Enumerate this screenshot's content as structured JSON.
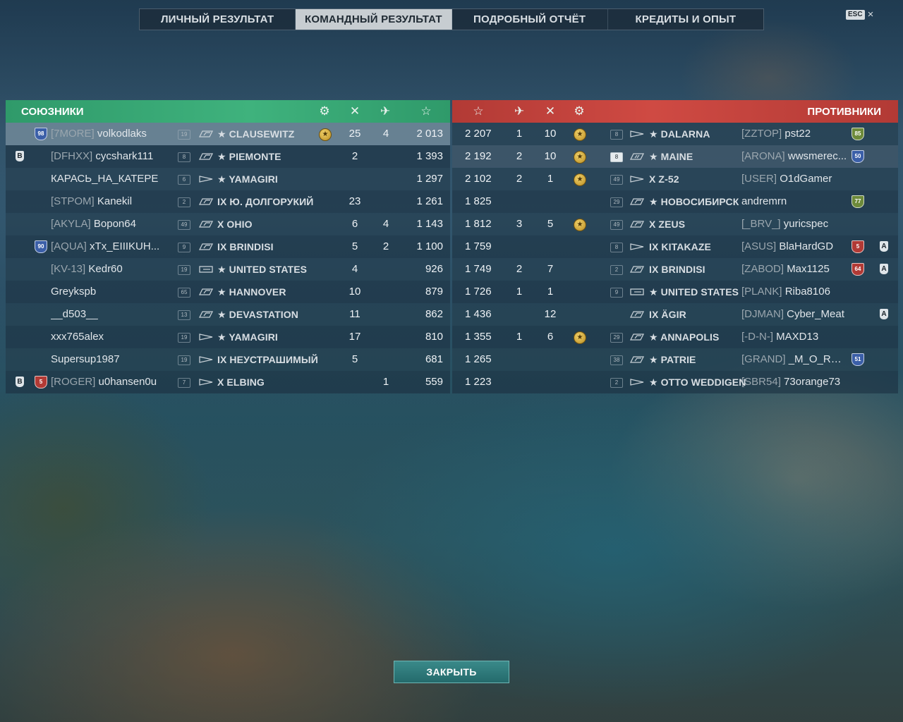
{
  "tabs": [
    {
      "label": "ЛИЧНЫЙ РЕЗУЛЬТАТ"
    },
    {
      "label": "КОМАНДНЫЙ РЕЗУЛЬТАТ"
    },
    {
      "label": "ПОДРОБНЫЙ ОТЧЁТ"
    },
    {
      "label": "КРЕДИТЫ И ОПЫТ"
    }
  ],
  "active_tab": "КОМАНДНЫЙ РЕЗУЛЬТАТ",
  "esc": {
    "key": "ESC",
    "close_icon": "×"
  },
  "colors": {
    "allies": "#3fb27d",
    "enemies": "#cf4a43",
    "row": "#1e3444",
    "highlight": "#768e9e"
  },
  "allies": {
    "title": "СОЮЗНИКИ",
    "header_icons": [
      "medal-icon",
      "frags-icon",
      "planes-icon",
      "xp-star-icon"
    ],
    "rows": [
      {
        "division": "",
        "badge": "98",
        "badge_color": "#3b5fa8",
        "clan": "[7MORE]",
        "name": "volkodlaks",
        "level": "19",
        "ship_class": "battleship",
        "ship": "★ CLAUSEWITZ",
        "medal": "1",
        "frags": "25",
        "planes": "4",
        "xp": "2 013",
        "me": true
      },
      {
        "division": "B",
        "badge": "",
        "badge_color": "",
        "clan": "[DFHXX]",
        "name": "cycshark111",
        "level": "8",
        "ship_class": "battleship",
        "ship": "★ PIEMONTE",
        "medal": "",
        "frags": "2",
        "planes": "",
        "xp": "1 393"
      },
      {
        "division": "",
        "badge": "",
        "badge_color": "",
        "clan": "",
        "name": "КАРАСЬ_НА_КАТЕРЕ",
        "level": "6",
        "ship_class": "destroyer",
        "ship": "★ YAMAGIRI",
        "medal": "",
        "frags": "",
        "planes": "",
        "xp": "1 297"
      },
      {
        "division": "",
        "badge": "",
        "badge_color": "",
        "clan": "[STPOM]",
        "name": "Kanekil",
        "level": "2",
        "ship_class": "battleship",
        "ship": "IX Ю. ДОЛГОРУКИЙ",
        "medal": "",
        "frags": "23",
        "planes": "",
        "xp": "1 261"
      },
      {
        "division": "",
        "badge": "",
        "badge_color": "",
        "clan": "[AKYLA]",
        "name": "Bopon64",
        "level": "49",
        "ship_class": "battleship",
        "ship": "X OHIO",
        "medal": "",
        "frags": "6",
        "planes": "4",
        "xp": "1 143"
      },
      {
        "division": "",
        "badge": "90",
        "badge_color": "#3b5fa8",
        "clan": "[AQUA]",
        "name": "xTx_EIIIKUH...",
        "level": "9",
        "ship_class": "battleship",
        "ship": "IX BRINDISI",
        "medal": "",
        "frags": "5",
        "planes": "2",
        "xp": "1 100"
      },
      {
        "division": "",
        "badge": "",
        "badge_color": "",
        "clan": "[KV-13]",
        "name": "Kedr60",
        "level": "19",
        "ship_class": "carrier",
        "ship": "★ UNITED STATES",
        "medal": "",
        "frags": "4",
        "planes": "",
        "xp": "926"
      },
      {
        "division": "",
        "badge": "",
        "badge_color": "",
        "clan": "",
        "name": "Greykspb",
        "level": "65",
        "ship_class": "battleship",
        "ship": "★ HANNOVER",
        "medal": "",
        "frags": "10",
        "planes": "",
        "xp": "879"
      },
      {
        "division": "",
        "badge": "",
        "badge_color": "",
        "clan": "",
        "name": "__d503__",
        "level": "13",
        "ship_class": "battleship",
        "ship": "★ DEVASTATION",
        "medal": "",
        "frags": "11",
        "planes": "",
        "xp": "862"
      },
      {
        "division": "",
        "badge": "",
        "badge_color": "",
        "clan": "",
        "name": "xxx765alex",
        "level": "19",
        "ship_class": "destroyer",
        "ship": "★ YAMAGIRI",
        "medal": "",
        "frags": "17",
        "planes": "",
        "xp": "810"
      },
      {
        "division": "",
        "badge": "",
        "badge_color": "",
        "clan": "",
        "name": "Supersup1987",
        "level": "19",
        "ship_class": "destroyer",
        "ship": "IX НЕУСТРАШИМЫЙ",
        "medal": "",
        "frags": "5",
        "planes": "",
        "xp": "681"
      },
      {
        "division": "B",
        "badge": "5",
        "badge_color": "#b23a35",
        "clan": "[ROGER]",
        "name": "u0hansen0u",
        "level": "7",
        "ship_class": "destroyer",
        "ship": "X ELBING",
        "medal": "",
        "frags": "",
        "planes": "1",
        "xp": "559"
      }
    ]
  },
  "enemies": {
    "title": "ПРОТИВНИКИ",
    "header_icons": [
      "xp-star-icon",
      "planes-icon",
      "frags-icon",
      "medal-icon"
    ],
    "rows": [
      {
        "division": "",
        "badge": "85",
        "badge_color": "#6d8a3a",
        "clan": "[ZZTOP]",
        "name": "pst22",
        "level": "8",
        "ship_class": "destroyer",
        "ship": "★ DALARNA",
        "medal": "1",
        "frags": "10",
        "planes": "1",
        "xp": "2 207"
      },
      {
        "division": "",
        "badge": "50",
        "badge_color": "#3b5fa8",
        "clan": "[ARONA]",
        "name": "wwsmerec...",
        "level": "8",
        "ship_class": "cruiser",
        "ship": "★ MAINE",
        "medal": "1",
        "frags": "10",
        "planes": "2",
        "xp": "2 192",
        "hl": true
      },
      {
        "division": "",
        "badge": "",
        "badge_color": "",
        "clan": "[USER]",
        "name": "O1dGamer",
        "level": "49",
        "ship_class": "destroyer",
        "ship": "X Z-52",
        "medal": "1",
        "frags": "1",
        "planes": "2",
        "xp": "2 102"
      },
      {
        "division": "",
        "badge": "77",
        "badge_color": "#6d8a3a",
        "clan": "",
        "name": "andremrn",
        "level": "29",
        "ship_class": "battleship",
        "ship": "★ НОВОСИБИРСК",
        "medal": "",
        "frags": "",
        "planes": "",
        "xp": "1 825"
      },
      {
        "division": "",
        "badge": "",
        "badge_color": "",
        "clan": "[_BRV_]",
        "name": "yuricspec",
        "level": "49",
        "ship_class": "battleship",
        "ship": "X ZEUS",
        "medal": "1",
        "frags": "5",
        "planes": "3",
        "xp": "1 812"
      },
      {
        "division": "A",
        "badge": "5",
        "badge_color": "#b23a35",
        "clan": "[ASUS]",
        "name": "BlaHardGD",
        "level": "8",
        "ship_class": "destroyer",
        "ship": "IX KITAKAZE",
        "medal": "",
        "frags": "",
        "planes": "",
        "xp": "1 759"
      },
      {
        "division": "A",
        "badge": "64",
        "badge_color": "#b23a35",
        "clan": "[ZABOD]",
        "name": "Max1125",
        "level": "2",
        "ship_class": "battleship",
        "ship": "IX BRINDISI",
        "medal": "",
        "frags": "7",
        "planes": "2",
        "xp": "1 749"
      },
      {
        "division": "",
        "badge": "",
        "badge_color": "",
        "clan": "[PLANK]",
        "name": "Riba8106",
        "level": "9",
        "ship_class": "carrier",
        "ship": "★ UNITED STATES",
        "medal": "",
        "frags": "1",
        "planes": "1",
        "xp": "1 726"
      },
      {
        "division": "A",
        "badge": "",
        "badge_color": "",
        "clan": "[DJMAN]",
        "name": "Cyber_Meat",
        "level": "",
        "ship_class": "battleship",
        "ship": "IX ÄGIR",
        "medal": "",
        "frags": "12",
        "planes": "",
        "xp": "1 436"
      },
      {
        "division": "",
        "badge": "",
        "badge_color": "",
        "clan": "[-D-N-]",
        "name": "MAXD13",
        "level": "29",
        "ship_class": "battleship",
        "ship": "★ ANNAPOLIS",
        "medal": "1",
        "frags": "6",
        "planes": "1",
        "xp": "1 355"
      },
      {
        "division": "",
        "badge": "51",
        "badge_color": "#3b5fa8",
        "clan": "[GRAND]",
        "name": "_M_O_R_P...",
        "level": "38",
        "ship_class": "battleship",
        "ship": "★ PATRIE",
        "medal": "",
        "frags": "",
        "planes": "",
        "xp": "1 265"
      },
      {
        "division": "",
        "badge": "",
        "badge_color": "",
        "clan": "[SBR54]",
        "name": "73orange73",
        "level": "2",
        "ship_class": "destroyer",
        "ship": "★ OTTO WEDDIGEN",
        "medal": "",
        "frags": "",
        "planes": "",
        "xp": "1 223"
      }
    ]
  },
  "close_button": "ЗАКРЫТЬ"
}
